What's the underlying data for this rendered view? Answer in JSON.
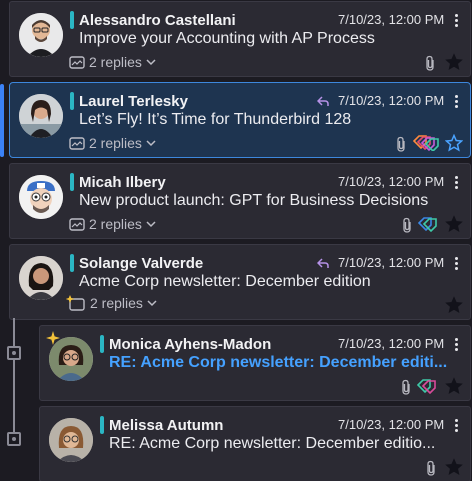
{
  "messages": [
    {
      "sender": "Alessandro Castellani",
      "date": "7/10/23, 12:00 PM",
      "subject": "Improve your Accounting with AP Process",
      "replies": "2 replies"
    },
    {
      "sender": "Laurel Terlesky",
      "date": "7/10/23, 12:00 PM",
      "subject": "Let’s Fly! It’s Time for Thunderbird 128",
      "replies": "2 replies"
    },
    {
      "sender": "Micah Ilbery",
      "date": "7/10/23, 12:00 PM",
      "subject": "New product launch: GPT for Business Decisions",
      "replies": "2 replies"
    },
    {
      "sender": "Solange Valverde",
      "date": "7/10/23, 12:00 PM",
      "subject": "Acme Corp newsletter: December edition",
      "replies": "2 replies"
    },
    {
      "sender": "Monica Ayhens-Madon",
      "date": "7/10/23, 12:00 PM",
      "subject": "RE: Acme Corp newsletter: December editi..."
    },
    {
      "sender": "Melissa Autumn",
      "date": "7/10/23, 12:00 PM",
      "subject": "RE: Acme Corp newsletter: December editio..."
    }
  ],
  "colors": {
    "accent": "#3d87dc",
    "tag": "#2bb6c4",
    "unread_link": "#45a1ff"
  },
  "icons": [
    "paperclip-icon",
    "star-icon",
    "reply-icon",
    "tags-icon",
    "kebab-menu-icon",
    "chevron-down-icon",
    "thread-icon",
    "sparkle-icon"
  ]
}
